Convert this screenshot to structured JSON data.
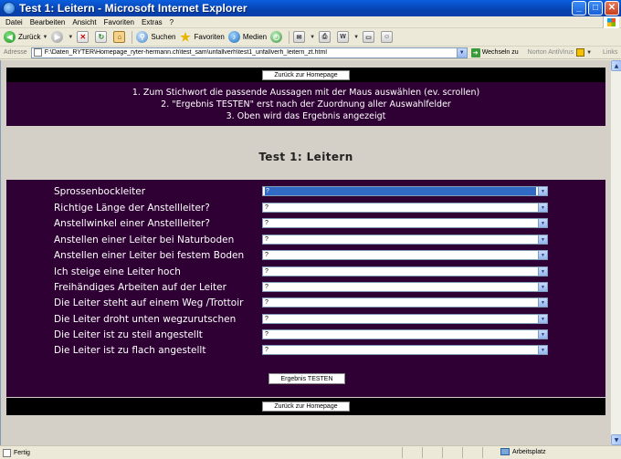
{
  "window": {
    "title": "Test 1: Leitern - Microsoft Internet Explorer",
    "min": "_",
    "max": "□",
    "close": "✕"
  },
  "menu": [
    "Datei",
    "Bearbeiten",
    "Ansicht",
    "Favoriten",
    "Extras",
    "?"
  ],
  "toolbar": {
    "back": "Zurück",
    "search": "Suchen",
    "favorites": "Favoriten",
    "media": "Medien"
  },
  "address": {
    "label": "Adresse",
    "url": "F:\\Daten_RYTER\\Homepage_ryter-hermann.ch\\test_sam\\unfallverh\\test1_unfallverh_leitern_zt.html",
    "go": "Wechseln zu",
    "norton": "Norton AntiVirus",
    "links": "Links"
  },
  "page": {
    "back_home": "Zurück zur Homepage",
    "instructions": [
      "1. Zum Stichwort die passende Aussagen mit der Maus auswählen (ev. scrollen)",
      "2. \"Ergebnis TESTEN\" erst nach der Zuordnung aller Auswahlfelder",
      "3. Oben wird das Ergebnis angezeigt"
    ],
    "title": "Test 1: Leitern",
    "questions": [
      {
        "label": "Sprossenbockleiter",
        "value": "?"
      },
      {
        "label": "Richtige Länge der Anstellleiter?",
        "value": "?"
      },
      {
        "label": "Anstellwinkel einer Anstellleiter?",
        "value": "?"
      },
      {
        "label": "Anstellen einer Leiter bei Naturboden",
        "value": "?"
      },
      {
        "label": "Anstellen einer Leiter bei festem Boden",
        "value": "?"
      },
      {
        "label": "Ich steige eine Leiter hoch",
        "value": "?"
      },
      {
        "label": "Freihändiges Arbeiten auf der Leiter",
        "value": "?"
      },
      {
        "label": "Die Leiter steht auf einem Weg /Trottoir",
        "value": "?"
      },
      {
        "label": "Die Leiter droht unten wegzurutschen",
        "value": "?"
      },
      {
        "label": "Die Leiter ist zu steil angestellt",
        "value": "?"
      },
      {
        "label": "Die Leiter ist zu flach angestellt",
        "value": "?"
      }
    ],
    "test_button": "Ergebnis TESTEN"
  },
  "status": {
    "text": "Fertig",
    "zone": "Arbeitsplatz"
  },
  "colors": {
    "panel": "#2E0033",
    "band": "#000000",
    "page_bg": "#D4D0C8"
  }
}
